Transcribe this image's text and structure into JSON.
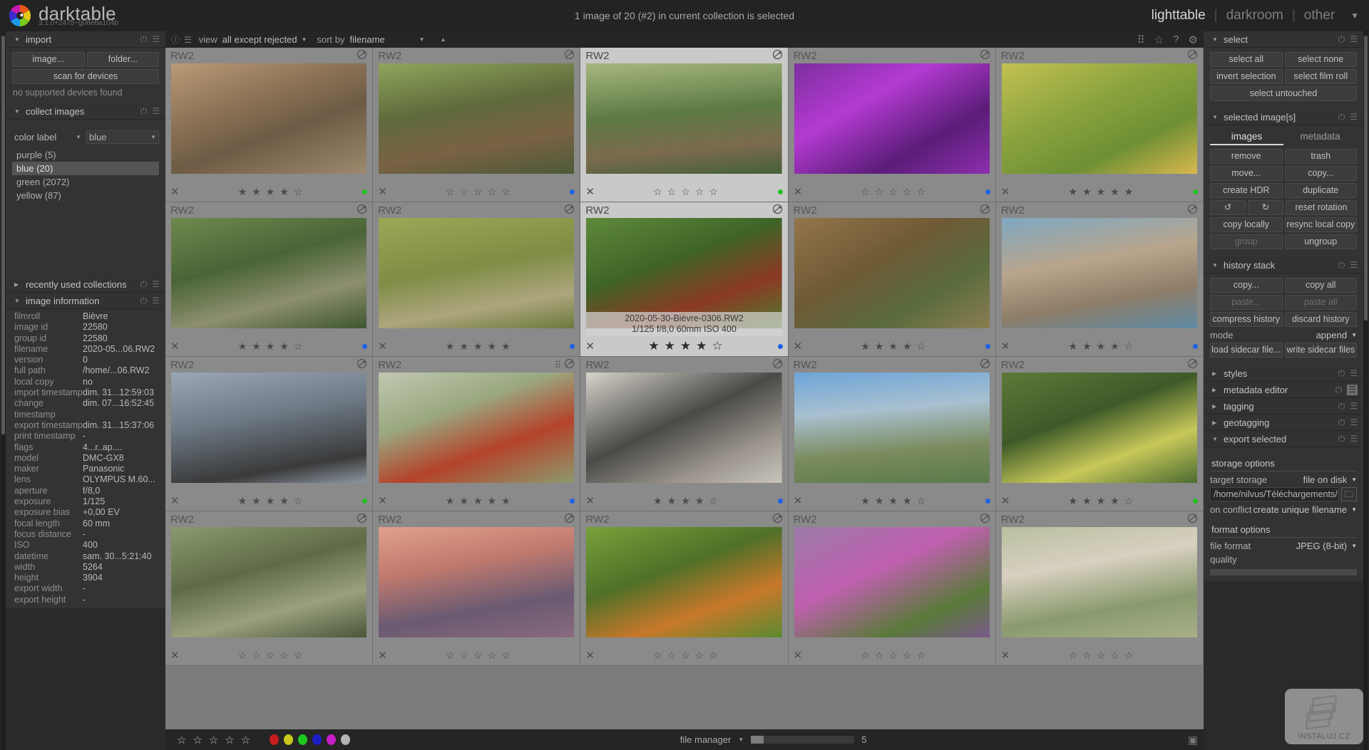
{
  "app": {
    "name": "darktable",
    "version": "3.1.0+2475~g08eba104b",
    "status": "1 image of 20 (#2) in current collection is selected",
    "views": [
      "lighttable",
      "darkroom",
      "other"
    ],
    "active_view": "lighttable"
  },
  "left": {
    "import": {
      "title": "import",
      "image_button": "image...",
      "folder_button": "folder...",
      "scan_button": "scan for devices",
      "note": "no supported devices found"
    },
    "collect": {
      "title": "collect images",
      "criterion": "color label",
      "value": "blue",
      "items": [
        {
          "label": "purple (5)",
          "selected": false
        },
        {
          "label": "blue (20)",
          "selected": true
        },
        {
          "label": "green (2072)",
          "selected": false
        },
        {
          "label": "yellow (87)",
          "selected": false
        }
      ]
    },
    "recent": {
      "title": "recently used collections"
    },
    "image_information": {
      "title": "image information",
      "rows": [
        {
          "k": "filmroll",
          "v": "Bièvre"
        },
        {
          "k": "image id",
          "v": "22580"
        },
        {
          "k": "group id",
          "v": "22580"
        },
        {
          "k": "filename",
          "v": "2020-05...06.RW2"
        },
        {
          "k": "version",
          "v": "0"
        },
        {
          "k": "full path",
          "v": "/home/...06.RW2"
        },
        {
          "k": "local copy",
          "v": "no"
        },
        {
          "k": "import timestamp",
          "v": "dim. 31...12:59:03"
        },
        {
          "k": "change timestamp",
          "v": "dim. 07...16:52:45"
        },
        {
          "k": "export timestamp",
          "v": "dim. 31...15:37:06"
        },
        {
          "k": "print timestamp",
          "v": "-"
        },
        {
          "k": "flags",
          "v": "4...r..ap...."
        },
        {
          "k": "model",
          "v": "DMC-GX8"
        },
        {
          "k": "maker",
          "v": "Panasonic"
        },
        {
          "k": "lens",
          "v": "OLYMPUS M.60..."
        },
        {
          "k": "aperture",
          "v": "f/8,0"
        },
        {
          "k": "exposure",
          "v": "1/125"
        },
        {
          "k": "exposure bias",
          "v": "+0,00 EV"
        },
        {
          "k": "focal length",
          "v": "60 mm"
        },
        {
          "k": "focus distance",
          "v": "-"
        },
        {
          "k": "ISO",
          "v": "400"
        },
        {
          "k": "datetime",
          "v": "sam. 30...5:21:40"
        },
        {
          "k": "width",
          "v": "5264"
        },
        {
          "k": "height",
          "v": "3904"
        },
        {
          "k": "export width",
          "v": "-"
        },
        {
          "k": "export height",
          "v": "-"
        }
      ]
    }
  },
  "center_toolbar": {
    "view_label": "view",
    "view_value": "all except rejected",
    "sort_label": "sort by",
    "sort_value": "filename"
  },
  "grid": {
    "cells": [
      {
        "ext": "RW2",
        "stars": 4,
        "dot": "#22c222",
        "tip": null,
        "highlight": false,
        "grouped": false
      },
      {
        "ext": "RW2",
        "stars": 0,
        "dot": "#1e62e8",
        "tip": null,
        "highlight": false,
        "grouped": false
      },
      {
        "ext": "RW2",
        "stars": 0,
        "dot": "#22c222",
        "tip": null,
        "highlight": true,
        "grouped": false
      },
      {
        "ext": "RW2",
        "stars": 0,
        "dot": "#1e62e8",
        "tip": null,
        "highlight": false,
        "grouped": false
      },
      {
        "ext": "RW2",
        "stars": 5,
        "dot": "#22c222",
        "tip": null,
        "highlight": false,
        "grouped": false
      },
      {
        "ext": "RW2",
        "stars": 4,
        "dot": "#1e62e8",
        "tip": null,
        "highlight": false,
        "grouped": false
      },
      {
        "ext": "RW2",
        "stars": 5,
        "dot": "#1e62e8",
        "tip": null,
        "highlight": false,
        "grouped": false
      },
      {
        "ext": "RW2",
        "stars": 4,
        "dot": "#1e62e8",
        "tip": "2020-05-30-Bièvre-0306.RW2\n1/125 f/8,0 60mm ISO 400",
        "highlight": true,
        "grouped": false
      },
      {
        "ext": "RW2",
        "stars": 4,
        "dot": "#1e62e8",
        "tip": null,
        "highlight": false,
        "grouped": false
      },
      {
        "ext": "RW2",
        "stars": 4,
        "dot": "#1e62e8",
        "tip": null,
        "highlight": false,
        "grouped": false
      },
      {
        "ext": "RW2",
        "stars": 4,
        "dot": "#22c222",
        "tip": null,
        "highlight": false,
        "grouped": false
      },
      {
        "ext": "RW2",
        "stars": 5,
        "dot": "#1e62e8",
        "tip": null,
        "highlight": false,
        "grouped": true
      },
      {
        "ext": "RW2",
        "stars": 4,
        "dot": "#1e62e8",
        "tip": null,
        "highlight": false,
        "grouped": false
      },
      {
        "ext": "RW2",
        "stars": 4,
        "dot": "#1e62e8",
        "tip": null,
        "highlight": false,
        "grouped": false
      },
      {
        "ext": "RW2",
        "stars": 4,
        "dot": "#22c222",
        "tip": null,
        "highlight": false,
        "grouped": false
      },
      {
        "ext": "RW2",
        "stars": 0,
        "dot": null,
        "tip": null,
        "highlight": false,
        "grouped": false
      },
      {
        "ext": "RW2",
        "stars": 0,
        "dot": null,
        "tip": null,
        "highlight": false,
        "grouped": false
      },
      {
        "ext": "RW2",
        "stars": 0,
        "dot": null,
        "tip": null,
        "highlight": false,
        "grouped": false
      },
      {
        "ext": "RW2",
        "stars": 0,
        "dot": null,
        "tip": null,
        "highlight": false,
        "grouped": false
      },
      {
        "ext": "RW2",
        "stars": 0,
        "dot": null,
        "tip": null,
        "highlight": false,
        "grouped": false
      }
    ]
  },
  "bottom": {
    "stars_label": "rating filter",
    "colors": [
      "#c81e1e",
      "#c8c81e",
      "#1ec81e",
      "#1e1ec8",
      "#c81ec8",
      "#b4b4b4"
    ],
    "layout": "file manager",
    "zoom_level": "5"
  },
  "right": {
    "select": {
      "title": "select",
      "buttons": [
        "select all",
        "select none",
        "invert selection",
        "select film roll",
        "select untouched"
      ]
    },
    "selected_images": {
      "title": "selected image[s]",
      "tabs": [
        "images",
        "metadata"
      ],
      "active_tab": "images",
      "buttons": [
        "remove",
        "trash",
        "move...",
        "copy...",
        "create HDR",
        "duplicate",
        "reset rotation",
        "copy locally",
        "resync local copy",
        "group",
        "ungroup"
      ],
      "rotate_ccw": "rotate counter-clockwise",
      "rotate_cw": "rotate clockwise"
    },
    "history_stack": {
      "title": "history stack",
      "buttons": [
        "copy...",
        "copy all",
        "paste...",
        "paste all",
        "compress history",
        "discard history"
      ],
      "mode_label": "mode",
      "mode_value": "append",
      "sidecar_buttons": [
        "load sidecar file...",
        "write sidecar files"
      ]
    },
    "collapsed": [
      {
        "title": "styles"
      },
      {
        "title": "metadata editor"
      },
      {
        "title": "tagging"
      },
      {
        "title": "geotagging"
      }
    ],
    "export": {
      "title": "export selected",
      "storage_options": "storage options",
      "target_storage_label": "target storage",
      "target_storage_value": "file on disk",
      "path": "/home/nilvus/Téléchargements/Im",
      "conflict_label": "on conflict",
      "conflict_value": "create unique filename",
      "format_options": "format options",
      "file_format_label": "file format",
      "file_format_value": "JPEG (8-bit)",
      "quality_label": "quality"
    }
  },
  "watermark": {
    "text": "INSTALUJ.CZ"
  }
}
